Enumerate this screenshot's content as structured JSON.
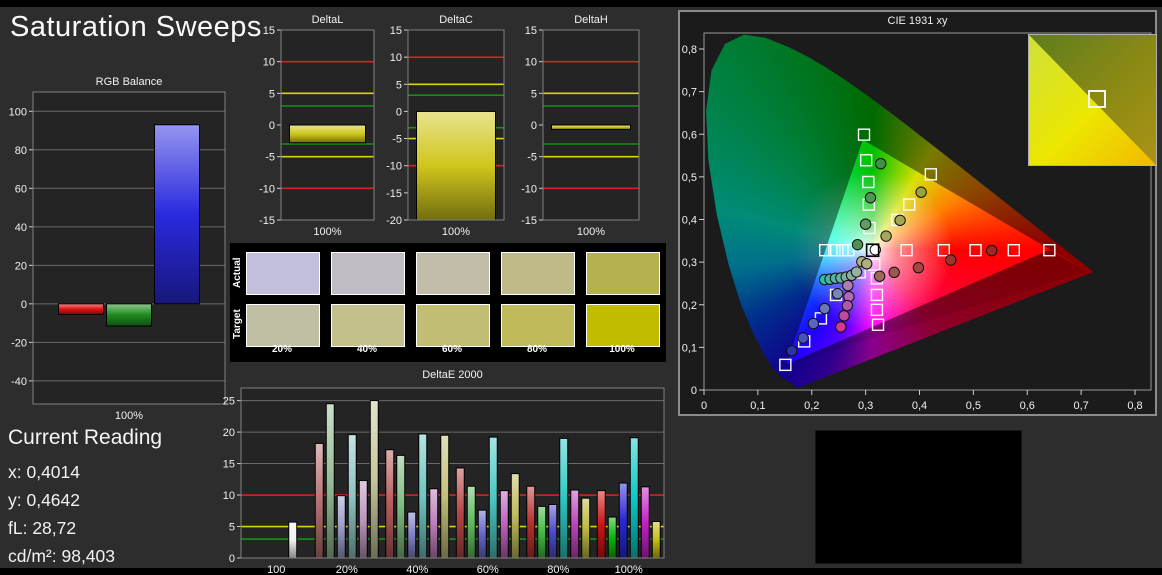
{
  "page": {
    "title": "Saturation Sweeps",
    "background": "#2d2d2d"
  },
  "current_reading": {
    "title": "Current Reading",
    "lines": [
      {
        "label": "x",
        "value": "0,4014"
      },
      {
        "label": "y",
        "value": "0,4642"
      },
      {
        "label": "fL",
        "value": "28,72"
      },
      {
        "label": "cd/m²",
        "value": "98,403"
      }
    ]
  },
  "swatch_table": {
    "row_labels": [
      "Actual",
      "Target"
    ],
    "col_labels": [
      "20%",
      "40%",
      "60%",
      "80%",
      "100%"
    ],
    "rows": {
      "actual": [
        "#c1bfdc",
        "#c1bcc4",
        "#c2bda9",
        "#bfba88",
        "#b5b14f"
      ],
      "target": [
        "#c0bfa3",
        "#c2c08b",
        "#c1bd75",
        "#c0ba5a",
        "#c1bc00"
      ]
    }
  },
  "colors": {
    "ref_red": "#d42222",
    "ref_yellow": "#d6d600",
    "ref_green": "#129212",
    "grid": "#6b6b6b",
    "axis": "#9a9a9a",
    "tick_text": "#f0f0f0"
  },
  "inset": {
    "bright_gradient": [
      "#cfe23a",
      "#ece600",
      "#f2b800"
    ],
    "dim_gradient": [
      "#5e7d1e",
      "#ab9316"
    ]
  },
  "chart_data": {
    "rgb_balance": {
      "type": "bar",
      "title": "RGB Balance",
      "ylim": [
        -52,
        110
      ],
      "yticks": [
        -40,
        -20,
        0,
        20,
        40,
        60,
        80,
        100
      ],
      "grid": true,
      "groups": [
        {
          "label": "100%",
          "bars": [
            {
              "v": -5.5,
              "c": "#dd1313",
              "name": "red"
            },
            {
              "v": -11.5,
              "c": "#1e8c1e",
              "name": "green"
            },
            {
              "v": 93,
              "c": "#2a2ae0",
              "name": "blue"
            }
          ]
        }
      ]
    },
    "delta_l": {
      "type": "bar",
      "title": "DeltaL",
      "ylim": [
        -15,
        15
      ],
      "yticks": [
        -15,
        -10,
        -5,
        0,
        5,
        10,
        15
      ],
      "grid": false,
      "reflines": {
        "red": 10,
        "yellow": 5,
        "green": 3,
        "mirrored": true
      },
      "groups": [
        {
          "label": "100%",
          "bars": [
            {
              "v": -2.8,
              "c": "#d0c61c"
            }
          ]
        }
      ]
    },
    "delta_c": {
      "type": "bar",
      "title": "DeltaC",
      "ylim": [
        -20,
        15
      ],
      "yticks": [
        -20,
        -15,
        -10,
        -5,
        0,
        5,
        10,
        15
      ],
      "grid": false,
      "reflines": {
        "red": 10,
        "yellow": 5,
        "green": 3,
        "mirrored": true
      },
      "groups": [
        {
          "label": "100%",
          "bars": [
            {
              "v": -20,
              "c": "#d0c61c"
            }
          ]
        }
      ]
    },
    "delta_h": {
      "type": "bar",
      "title": "DeltaH",
      "ylim": [
        -15,
        15
      ],
      "yticks": [
        -15,
        -10,
        -5,
        0,
        5,
        10,
        15
      ],
      "grid": false,
      "reflines": {
        "red": 10,
        "yellow": 5,
        "green": 3,
        "mirrored": true
      },
      "groups": [
        {
          "label": "100%",
          "bars": [
            {
              "v": -0.7,
              "c": "#d0c61c"
            }
          ]
        }
      ]
    },
    "delta_e2000": {
      "type": "bar",
      "title": "DeltaE 2000",
      "ylim": [
        0,
        27
      ],
      "yticks": [
        0,
        5,
        10,
        15,
        20,
        25
      ],
      "grid": true,
      "reflines": {
        "red": 10,
        "yellow": 5,
        "green": 3,
        "mirrored": false
      },
      "groups": [
        {
          "label": "100",
          "slot": 4,
          "bars": [
            {
              "v": 5.7,
              "c": "#f2f2f2"
            }
          ]
        },
        {
          "label": "20%",
          "bars": [
            {
              "v": 18.2,
              "c": "#b97272"
            },
            {
              "v": 24.5,
              "c": "#97bd97"
            },
            {
              "v": 9.9,
              "c": "#9c9cc8"
            },
            {
              "v": 19.6,
              "c": "#8fc4c0"
            },
            {
              "v": 12.3,
              "c": "#bd97bd"
            },
            {
              "v": 25.0,
              "c": "#c6c69c"
            }
          ]
        },
        {
          "label": "40%",
          "bars": [
            {
              "v": 17.2,
              "c": "#b65c5c"
            },
            {
              "v": 16.3,
              "c": "#7fbb7f"
            },
            {
              "v": 7.3,
              "c": "#8080c6"
            },
            {
              "v": 19.7,
              "c": "#6fc6c2"
            },
            {
              "v": 11.0,
              "c": "#bb7fbb"
            },
            {
              "v": 19.5,
              "c": "#c2bf79"
            }
          ]
        },
        {
          "label": "60%",
          "bars": [
            {
              "v": 14.3,
              "c": "#b64646"
            },
            {
              "v": 11.4,
              "c": "#62bb62"
            },
            {
              "v": 7.6,
              "c": "#6666c9"
            },
            {
              "v": 19.2,
              "c": "#4cc8c4"
            },
            {
              "v": 10.7,
              "c": "#bb62bb"
            },
            {
              "v": 13.4,
              "c": "#bfbb5c"
            }
          ]
        },
        {
          "label": "80%",
          "bars": [
            {
              "v": 11.4,
              "c": "#b93030"
            },
            {
              "v": 8.2,
              "c": "#42bb42"
            },
            {
              "v": 8.5,
              "c": "#4c4ccc"
            },
            {
              "v": 19.0,
              "c": "#2cc9c5"
            },
            {
              "v": 10.8,
              "c": "#bb46bb"
            },
            {
              "v": 9.5,
              "c": "#bdb941"
            }
          ]
        },
        {
          "label": "100%",
          "bars": [
            {
              "v": 10.7,
              "c": "#cc1414"
            },
            {
              "v": 6.5,
              "c": "#0ab50a"
            },
            {
              "v": 11.9,
              "c": "#2828d4"
            },
            {
              "v": 19.1,
              "c": "#0cc9c5"
            },
            {
              "v": 11.3,
              "c": "#c421c4"
            },
            {
              "v": 5.8,
              "c": "#c6bd14"
            }
          ]
        }
      ]
    },
    "cie": {
      "type": "scatter",
      "title": "CIE 1931 xy",
      "xticks": [
        0,
        0.1,
        0.2,
        0.3,
        0.4,
        0.5,
        0.6,
        0.7,
        0.8
      ],
      "yticks": [
        0,
        0.1,
        0.2,
        0.3,
        0.4,
        0.5,
        0.6,
        0.7,
        0.8
      ],
      "native_gamut": [
        [
          0.712,
          0.278
        ],
        [
          0.295,
          0.587
        ],
        [
          0.153,
          0.059
        ]
      ],
      "ref_gamut": [
        [
          0.641,
          0.329
        ],
        [
          0.297,
          0.599
        ],
        [
          0.151,
          0.059
        ]
      ],
      "white_point": [
        0.313,
        0.328
      ],
      "targets": [
        [
          0.297,
          0.599
        ],
        [
          0.301,
          0.539
        ],
        [
          0.305,
          0.488
        ],
        [
          0.306,
          0.435
        ],
        [
          0.307,
          0.38
        ],
        [
          0.359,
          0.399
        ],
        [
          0.381,
          0.435
        ],
        [
          0.421,
          0.506
        ],
        [
          0.376,
          0.328
        ],
        [
          0.445,
          0.328
        ],
        [
          0.504,
          0.328
        ],
        [
          0.575,
          0.328
        ],
        [
          0.641,
          0.328
        ],
        [
          0.225,
          0.328
        ],
        [
          0.242,
          0.328
        ],
        [
          0.257,
          0.328
        ],
        [
          0.268,
          0.328
        ],
        [
          0.316,
          0.294
        ],
        [
          0.321,
          0.262
        ],
        [
          0.321,
          0.223
        ],
        [
          0.321,
          0.188
        ],
        [
          0.323,
          0.153
        ],
        [
          0.289,
          0.276
        ],
        [
          0.245,
          0.223
        ],
        [
          0.217,
          0.168
        ],
        [
          0.186,
          0.114
        ],
        [
          0.151,
          0.059
        ]
      ],
      "measurements": [
        [
          0.328,
          0.531,
          "#3f9149"
        ],
        [
          0.309,
          0.451,
          "#4f9655"
        ],
        [
          0.3,
          0.389,
          "#619c62"
        ],
        [
          0.285,
          0.341,
          "#4f9150"
        ],
        [
          0.403,
          0.464,
          "#9aa33c"
        ],
        [
          0.364,
          0.398,
          "#a3a850"
        ],
        [
          0.338,
          0.361,
          "#a8a55c"
        ],
        [
          0.293,
          0.301,
          "#b2b184"
        ],
        [
          0.302,
          0.296,
          "#aeae7e"
        ],
        [
          0.534,
          0.327,
          "#a22424"
        ],
        [
          0.458,
          0.305,
          "#9c332c"
        ],
        [
          0.398,
          0.287,
          "#a24840"
        ],
        [
          0.353,
          0.276,
          "#9c584e"
        ],
        [
          0.326,
          0.267,
          "#a1665a"
        ],
        [
          0.224,
          0.259,
          "#27c0a4"
        ],
        [
          0.234,
          0.26,
          "#43b9a2"
        ],
        [
          0.244,
          0.262,
          "#57b4a1"
        ],
        [
          0.254,
          0.263,
          "#68b1a1"
        ],
        [
          0.264,
          0.265,
          "#79afa2"
        ],
        [
          0.274,
          0.269,
          "#88ada1"
        ],
        [
          0.283,
          0.277,
          "#97b0a2"
        ],
        [
          0.248,
          0.226,
          "#7b86b8"
        ],
        [
          0.224,
          0.191,
          "#6a76b8"
        ],
        [
          0.203,
          0.156,
          "#5a66bb"
        ],
        [
          0.184,
          0.122,
          "#4853b8"
        ],
        [
          0.163,
          0.092,
          "#2a34a8"
        ],
        [
          0.267,
          0.245,
          "#b27cb2"
        ],
        [
          0.269,
          0.219,
          "#b169b1"
        ],
        [
          0.266,
          0.198,
          "#b256aa"
        ],
        [
          0.26,
          0.174,
          "#c04a9a"
        ],
        [
          0.254,
          0.148,
          "#d23a8c"
        ],
        [
          0.318,
          0.329,
          "#ffffff"
        ]
      ]
    }
  }
}
